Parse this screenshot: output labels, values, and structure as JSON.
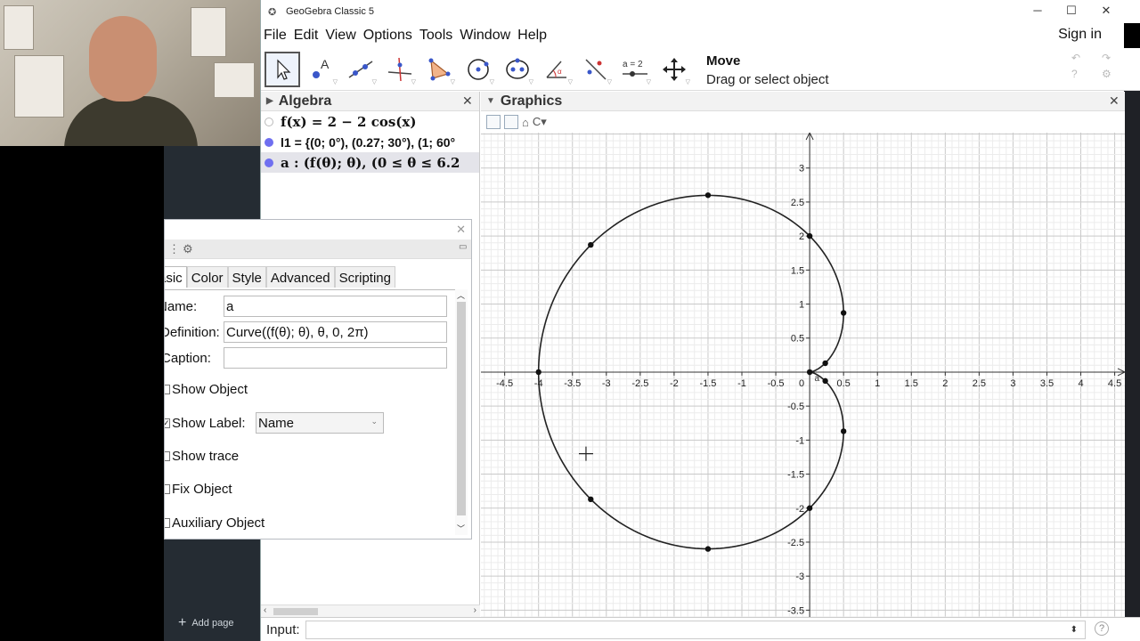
{
  "window": {
    "title": "GeoGebra Classic 5"
  },
  "menu": [
    "File",
    "Edit",
    "View",
    "Options",
    "Tools",
    "Window",
    "Help"
  ],
  "sign_in": "Sign in",
  "toolbar": {
    "tools": [
      "move-tool",
      "point-tool",
      "line-tool",
      "perpendicular-line-tool",
      "polygon-tool",
      "circle-tool",
      "conic-tool",
      "angle-tool",
      "reflect-tool",
      "slider-tool",
      "move-graphics-view-tool"
    ],
    "slider_label": "a = 2",
    "tool_name": "Move",
    "tool_help": "Drag or select object"
  },
  "algebra": {
    "title": "Algebra",
    "items": [
      {
        "text": "f(x)  =  2 − 2  cos(x)",
        "visible": false
      },
      {
        "text": "l1 = {(0; 0°), (0.27; 30°), (1; 60°",
        "visible": true
      },
      {
        "text": "a :  (f(θ); θ),     (0 ≤ θ ≤ 6.2",
        "visible": true
      }
    ]
  },
  "graphics": {
    "title": "Graphics",
    "x_ticks": [
      "-4.5",
      "-4",
      "-3.5",
      "-3",
      "-2.5",
      "-2",
      "-1.5",
      "-1",
      "-0.5",
      "0",
      "0.5",
      "1",
      "1.5",
      "2",
      "2.5",
      "3",
      "3.5",
      "4",
      "4.5"
    ],
    "y_ticks": [
      "3",
      "2.5",
      "2",
      "1.5",
      "1",
      "0.5",
      "-0.5",
      "-1",
      "-1.5",
      "-2",
      "-2.5",
      "-3",
      "-3.5"
    ],
    "label_a": "a"
  },
  "chart_data": {
    "type": "line",
    "title": "",
    "xlabel": "",
    "ylabel": "",
    "xlim": [
      -4.85,
      4.65
    ],
    "ylim": [
      -3.6,
      3.52
    ],
    "grid": true,
    "series": [
      {
        "name": "a",
        "description_curve": "cardioid r = 2 − 2cos(θ) in polar coordinates"
      }
    ],
    "points": [
      {
        "x": 0,
        "y": 0
      },
      {
        "x": 0.23,
        "y": 0.13
      },
      {
        "x": 0.5,
        "y": 0.87
      },
      {
        "x": 0,
        "y": 2
      },
      {
        "x": -1.5,
        "y": 2.6
      },
      {
        "x": -3.23,
        "y": 1.87
      },
      {
        "x": -4,
        "y": 0
      },
      {
        "x": -3.23,
        "y": -1.87
      },
      {
        "x": -1.5,
        "y": -2.6
      },
      {
        "x": 0,
        "y": -2
      },
      {
        "x": 0.5,
        "y": -0.87
      },
      {
        "x": 0.23,
        "y": -0.13
      }
    ]
  },
  "properties": {
    "tabs": [
      "asic",
      "Color",
      "Style",
      "Advanced",
      "Scripting"
    ],
    "name_label": "Name:",
    "name_value": "a",
    "definition_label": "Definition:",
    "definition_value": "Curve((f(θ); θ), θ, 0, 2π)",
    "caption_label": "Caption:",
    "caption_value": "",
    "show_object": "Show Object",
    "show_label": "Show Label:",
    "show_label_value": "Name",
    "show_trace": "Show trace",
    "fix_object": "Fix Object",
    "auxiliary_object": "Auxiliary Object"
  },
  "input_bar": {
    "label": "Input:",
    "value": ""
  },
  "add_page": "Add page"
}
